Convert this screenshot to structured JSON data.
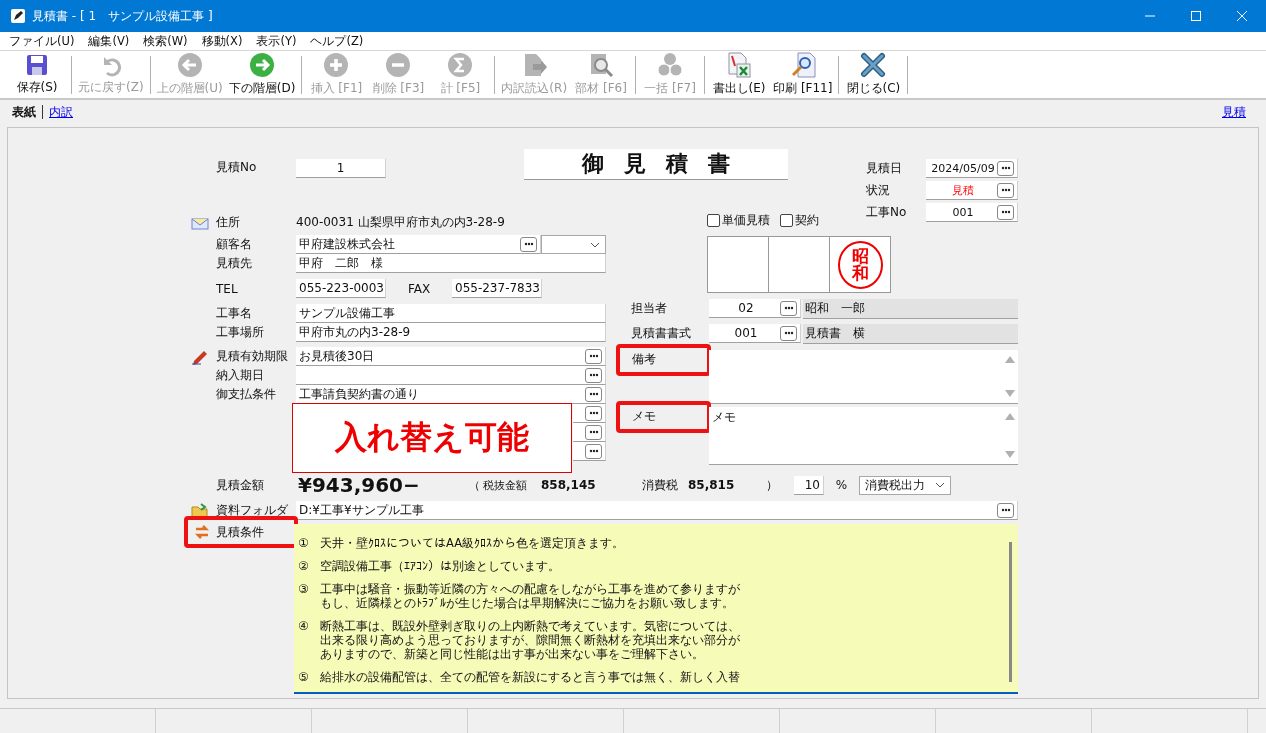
{
  "window": {
    "title": "見積書 - [ 1　サンプル設備工事 ]"
  },
  "menu": [
    {
      "label": "ファイル(U)"
    },
    {
      "label": "編集(V)"
    },
    {
      "label": "検索(W)"
    },
    {
      "label": "移動(X)"
    },
    {
      "label": "表示(Y)"
    },
    {
      "label": "ヘルプ(Z)"
    }
  ],
  "toolbar_groups": [
    {
      "buttons": [
        {
          "kind": "save",
          "label": "保存(S)",
          "disabled": false
        }
      ]
    },
    {
      "buttons": [
        {
          "kind": "undo",
          "label": "元に戻す(Z)",
          "disabled": true
        }
      ]
    },
    {
      "buttons": [
        {
          "kind": "up",
          "label": "上の階層(U)",
          "disabled": true
        },
        {
          "kind": "down",
          "label": "下の階層(D)",
          "disabled": false
        }
      ]
    },
    {
      "buttons": [
        {
          "kind": "insert",
          "label": "挿入 [F1]",
          "disabled": true
        },
        {
          "kind": "delete",
          "label": "削除 [F3]",
          "disabled": true
        },
        {
          "kind": "sum",
          "label": "計 [F5]",
          "disabled": true
        }
      ]
    },
    {
      "buttons": [
        {
          "kind": "import",
          "label": "内訳読込(R)",
          "disabled": true
        },
        {
          "kind": "parts",
          "label": "部材 [F6]",
          "disabled": true
        }
      ]
    },
    {
      "buttons": [
        {
          "kind": "bulk",
          "label": "一括 [F7]",
          "disabled": true
        }
      ]
    },
    {
      "buttons": [
        {
          "kind": "export",
          "label": "書出し(E)",
          "disabled": false
        },
        {
          "kind": "print",
          "label": "印刷 [F11]",
          "disabled": false
        }
      ]
    },
    {
      "buttons": [
        {
          "kind": "close",
          "label": "閉じる(C)",
          "disabled": false
        }
      ]
    }
  ],
  "tabs": [
    {
      "label": "表紙",
      "selected": true
    },
    {
      "label": "内訳",
      "selected": false
    }
  ],
  "right_link": "見積",
  "estimate_no": {
    "label": "見積No",
    "value": "1"
  },
  "doc_title": "御見積書",
  "header_right": [
    {
      "label": "見積日",
      "value": "2024/05/09",
      "emphasized": false
    },
    {
      "label": "状況",
      "value": "見積",
      "emphasized": true
    },
    {
      "label": "工事No",
      "value": "001",
      "emphasized": false
    }
  ],
  "left_fields": [
    {
      "kind": "address",
      "label": "住所",
      "value": "400-0031 山梨県甲府市丸の内3-28-9"
    },
    {
      "kind": "combo",
      "label": "顧客名",
      "value": "甲府建設株式会社"
    },
    {
      "kind": "field",
      "label": "見積先",
      "value": "甲府　二郎　様"
    },
    {
      "kind": "phone",
      "label": "TEL",
      "value": "055-223-0003",
      "fax_label": "FAX",
      "fax_value": "055-237-7833"
    },
    {
      "kind": "field",
      "label": "工事名",
      "value": "サンプル設備工事"
    },
    {
      "kind": "field",
      "label": "工事場所",
      "value": "甲府市丸の内3-28-9"
    },
    {
      "kind": "browse",
      "label": "見積有効期限",
      "value": "お見積後30日"
    },
    {
      "kind": "browse",
      "label": "納入期日"
    },
    {
      "kind": "browse",
      "label": "御支払条件",
      "value": "工事請負契約書の通り"
    },
    {
      "kind": "covered_browse"
    },
    {
      "kind": "covered_browse"
    },
    {
      "kind": "covered_browse"
    }
  ],
  "callout": "入れ替え可能",
  "checkboxes": [
    {
      "label": "単価見積",
      "checked": false
    },
    {
      "label": "契約",
      "checked": false
    }
  ],
  "stamp_boxes": [
    {
      "stamped": false
    },
    {
      "stamped": false
    },
    {
      "stamped": true,
      "seal": "昭和"
    }
  ],
  "right_fields": [
    {
      "kind": "code",
      "label": "担当者",
      "code": "02",
      "name": "昭和　一郎"
    },
    {
      "kind": "code",
      "label": "見積書書式",
      "code": "001",
      "name": "見積書　横"
    },
    {
      "kind": "memo",
      "label": "備考",
      "highlighted": true
    },
    {
      "kind": "memo",
      "label": "メモ",
      "value": "メモ",
      "highlighted": true
    }
  ],
  "amount": {
    "label": "見積金額",
    "value": "¥943,960−",
    "excl_label": "（ 税抜金額",
    "excl_value": "858,145",
    "tax_label": "消費税",
    "tax_value": "85,815",
    "close": "）",
    "rate": "10",
    "percent": "%",
    "tax_mode": "消費税出力"
  },
  "folder": {
    "label": "資料フォルダ",
    "value": "D:¥工事¥サンプル工事"
  },
  "conditions": {
    "label": "見積条件",
    "highlighted": true,
    "items": [
      {
        "mark": "①",
        "lines": [
          "天井・壁ｸﾛｽについてはAA級ｸﾛｽから色を選定頂きます。"
        ]
      },
      {
        "mark": "②",
        "lines": [
          "空調設備工事（ｴｱｺﾝ）は別途としています。"
        ]
      },
      {
        "mark": "③",
        "lines": [
          "工事中は騒音・振動等近隣の方々への配慮をしながら工事を進めて参りますが",
          "もし、近隣様とのﾄﾗﾌﾞﾙが生じた場合は早期解決にご協力をお願い致します。"
        ]
      },
      {
        "mark": "④",
        "lines": [
          "断熱工事は、既設外壁剥ぎ取りの上内断熱で考えています。気密については、",
          "出来る限り高めよう思っておりますが、隙間無く断熱材を充填出来ない部分が",
          "ありますので、新築と同じ性能は出す事が出来ない事をご理解下さい。"
        ]
      },
      {
        "mark": "⑤",
        "lines": [
          "給排水の設備配管は、全ての配管を新設にすると言う事では無く、新しく入替"
        ]
      }
    ]
  }
}
